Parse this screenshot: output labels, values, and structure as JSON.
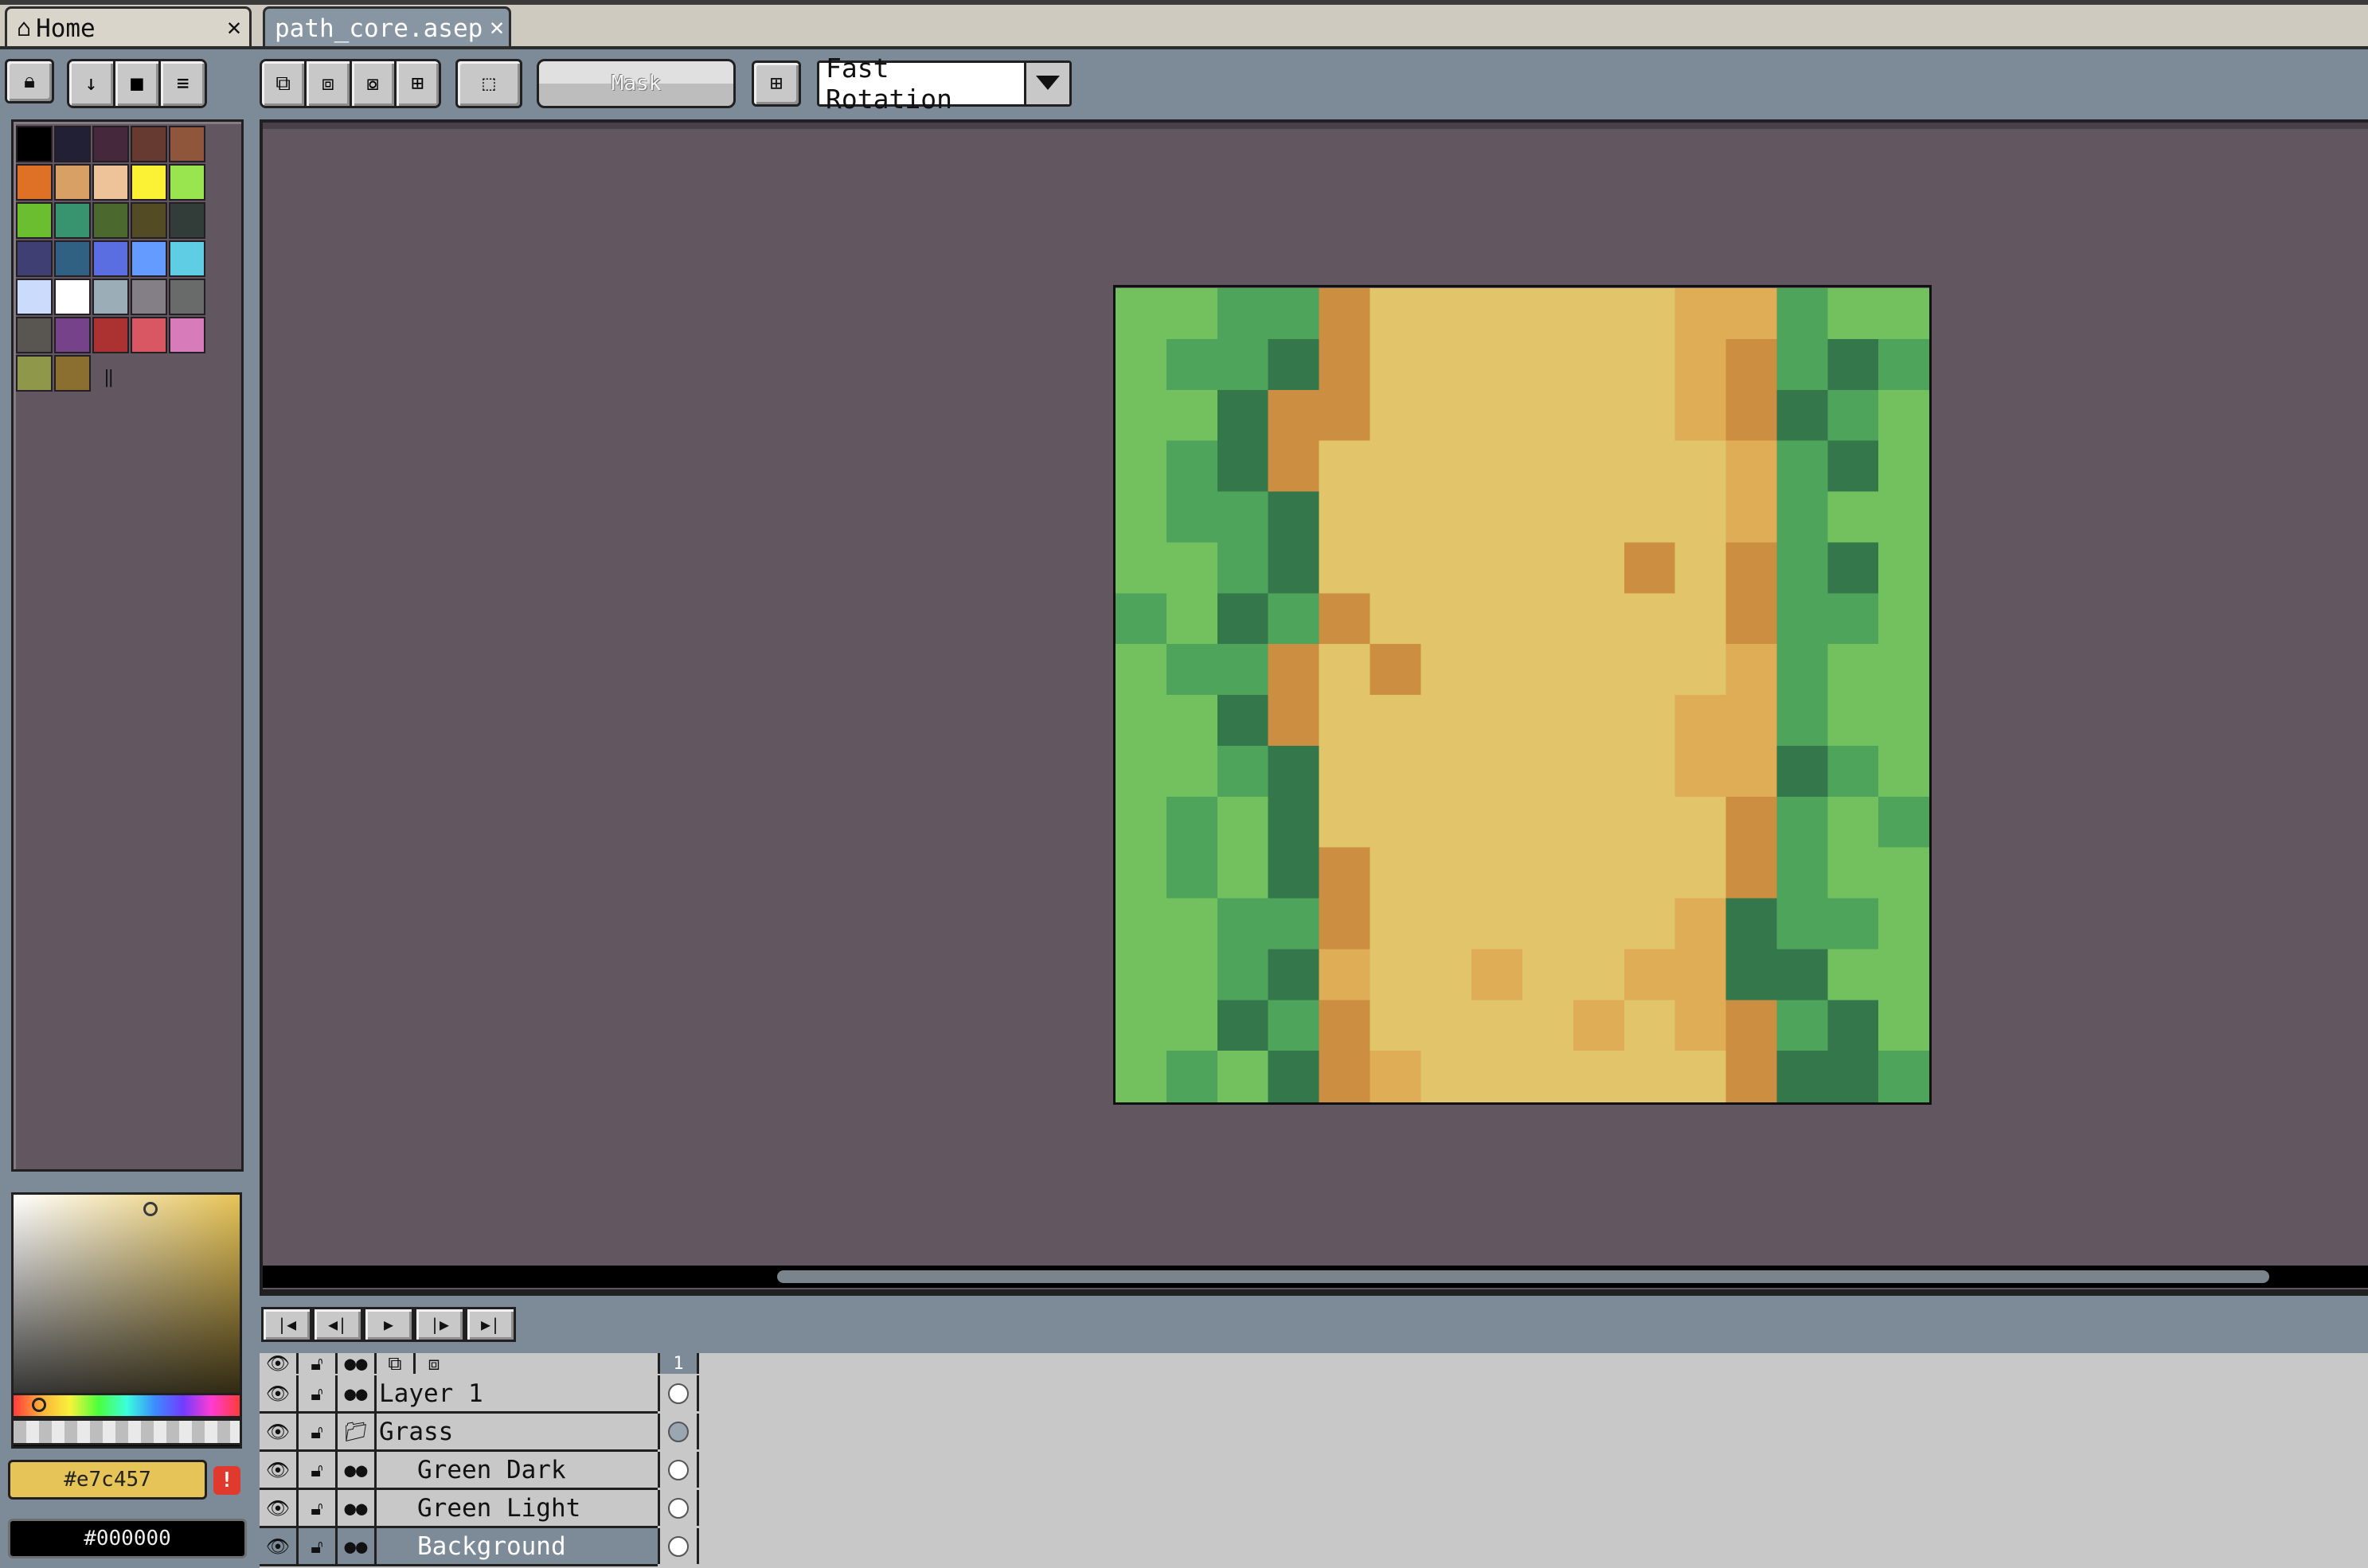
{
  "tabs": [
    {
      "label": "Home",
      "icon": "home-icon",
      "active": false
    },
    {
      "label": "path_core.asep",
      "active": true
    }
  ],
  "toolbar": {
    "mask_label": "Mask",
    "rotation_value": "Fast Rotation"
  },
  "palette": [
    "#000000",
    "#222034",
    "#45283c",
    "#663931",
    "#8f563b",
    "#df7126",
    "#d9a066",
    "#eec39a",
    "#fbf236",
    "#99e550",
    "#6abe30",
    "#37946e",
    "#4b692f",
    "#524b24",
    "#323c39",
    "#3f3f74",
    "#306082",
    "#5b6ee1",
    "#639bff",
    "#5fcde4",
    "#cbdbfc",
    "#ffffff",
    "#9badb7",
    "#847e87",
    "#696a6a",
    "#595652",
    "#76428a",
    "#ac3232",
    "#d95763",
    "#d77bba",
    "#8f974a",
    "#8a6f30"
  ],
  "colors": {
    "foreground": "#e7c457",
    "background": "#000000"
  },
  "timeline": {
    "frame_header": "1",
    "layers": [
      {
        "name": "Layer 1",
        "indent": false,
        "group": false,
        "selected": false
      },
      {
        "name": "Grass",
        "indent": false,
        "group": true,
        "selected": false
      },
      {
        "name": "Green Dark",
        "indent": true,
        "group": false,
        "selected": false
      },
      {
        "name": "Green Light",
        "indent": true,
        "group": false,
        "selected": false
      },
      {
        "name": "Background",
        "indent": true,
        "group": false,
        "selected": true
      }
    ]
  },
  "sprite": {
    "colors": {
      "G": "#72c05e",
      "M": "#4ea45a",
      "D": "#33774a",
      "S": "#e2c46a",
      "s": "#e0ad57",
      "O": "#cc8f42"
    },
    "rows": [
      "GGMMOSSSSSSssMGG",
      "GMMDOSSSSSSsOMDM",
      "GGDOOSSSSSSsODMG",
      "GMDOSSSSSSSSsMDG",
      "GMMDSSSSSSSSsMGG",
      "GGMDSSSSSSOSOMDG",
      "MGDMOSSSSSSSOMMG",
      "GMMOSOSSSSSSsMGG",
      "GGDOSSSSSSSssMGG",
      "GGMDSSSSSSSssDMG",
      "GMGDSSSSSSSSOMGM",
      "GMGDOSSSSSSSOMGG",
      "GGMMOSSSSSSsDMMG",
      "GGMDsSSsSSssDDGG",
      "GGDMOSSSSsSsOMDG",
      "GMGDOsSSSSSSODDM"
    ]
  }
}
